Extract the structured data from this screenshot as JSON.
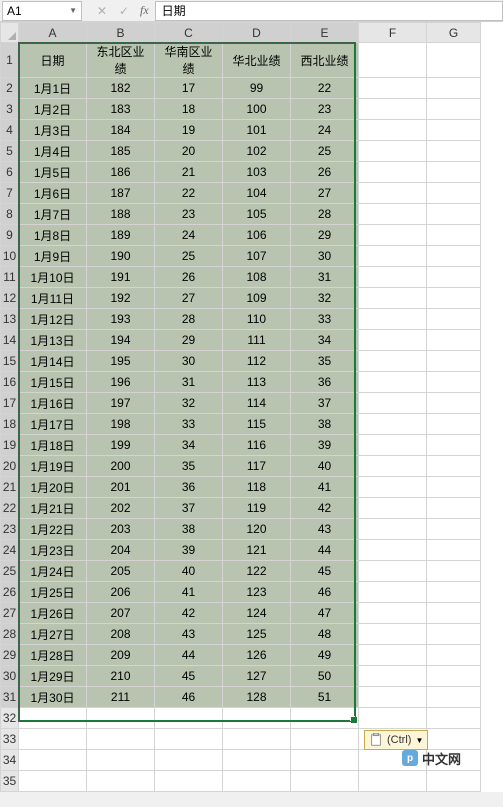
{
  "namebox": {
    "ref": "A1"
  },
  "formula_bar": {
    "value": "日期"
  },
  "columns": [
    "A",
    "B",
    "C",
    "D",
    "E",
    "F",
    "G"
  ],
  "row_headers": [
    1,
    2,
    3,
    4,
    5,
    6,
    7,
    8,
    9,
    10,
    11,
    12,
    13,
    14,
    15,
    16,
    17,
    18,
    19,
    20,
    21,
    22,
    23,
    24,
    25,
    26,
    27,
    28,
    29,
    30,
    31,
    32,
    33,
    34,
    35
  ],
  "headers": [
    "日期",
    "东北区业绩",
    "华南区业绩",
    "华北业绩",
    "西北业绩"
  ],
  "rows": [
    {
      "date": "1月1日",
      "ne": 182,
      "sc": 17,
      "nc": 99,
      "nw": 22
    },
    {
      "date": "1月2日",
      "ne": 183,
      "sc": 18,
      "nc": 100,
      "nw": 23
    },
    {
      "date": "1月3日",
      "ne": 184,
      "sc": 19,
      "nc": 101,
      "nw": 24
    },
    {
      "date": "1月4日",
      "ne": 185,
      "sc": 20,
      "nc": 102,
      "nw": 25
    },
    {
      "date": "1月5日",
      "ne": 186,
      "sc": 21,
      "nc": 103,
      "nw": 26
    },
    {
      "date": "1月6日",
      "ne": 187,
      "sc": 22,
      "nc": 104,
      "nw": 27
    },
    {
      "date": "1月7日",
      "ne": 188,
      "sc": 23,
      "nc": 105,
      "nw": 28
    },
    {
      "date": "1月8日",
      "ne": 189,
      "sc": 24,
      "nc": 106,
      "nw": 29
    },
    {
      "date": "1月9日",
      "ne": 190,
      "sc": 25,
      "nc": 107,
      "nw": 30
    },
    {
      "date": "1月10日",
      "ne": 191,
      "sc": 26,
      "nc": 108,
      "nw": 31
    },
    {
      "date": "1月11日",
      "ne": 192,
      "sc": 27,
      "nc": 109,
      "nw": 32
    },
    {
      "date": "1月12日",
      "ne": 193,
      "sc": 28,
      "nc": 110,
      "nw": 33
    },
    {
      "date": "1月13日",
      "ne": 194,
      "sc": 29,
      "nc": 111,
      "nw": 34
    },
    {
      "date": "1月14日",
      "ne": 195,
      "sc": 30,
      "nc": 112,
      "nw": 35
    },
    {
      "date": "1月15日",
      "ne": 196,
      "sc": 31,
      "nc": 113,
      "nw": 36
    },
    {
      "date": "1月16日",
      "ne": 197,
      "sc": 32,
      "nc": 114,
      "nw": 37
    },
    {
      "date": "1月17日",
      "ne": 198,
      "sc": 33,
      "nc": 115,
      "nw": 38
    },
    {
      "date": "1月18日",
      "ne": 199,
      "sc": 34,
      "nc": 116,
      "nw": 39
    },
    {
      "date": "1月19日",
      "ne": 200,
      "sc": 35,
      "nc": 117,
      "nw": 40
    },
    {
      "date": "1月20日",
      "ne": 201,
      "sc": 36,
      "nc": 118,
      "nw": 41
    },
    {
      "date": "1月21日",
      "ne": 202,
      "sc": 37,
      "nc": 119,
      "nw": 42
    },
    {
      "date": "1月22日",
      "ne": 203,
      "sc": 38,
      "nc": 120,
      "nw": 43
    },
    {
      "date": "1月23日",
      "ne": 204,
      "sc": 39,
      "nc": 121,
      "nw": 44
    },
    {
      "date": "1月24日",
      "ne": 205,
      "sc": 40,
      "nc": 122,
      "nw": 45
    },
    {
      "date": "1月25日",
      "ne": 206,
      "sc": 41,
      "nc": 123,
      "nw": 46
    },
    {
      "date": "1月26日",
      "ne": 207,
      "sc": 42,
      "nc": 124,
      "nw": 47
    },
    {
      "date": "1月27日",
      "ne": 208,
      "sc": 43,
      "nc": 125,
      "nw": 48
    },
    {
      "date": "1月28日",
      "ne": 209,
      "sc": 44,
      "nc": 126,
      "nw": 49
    },
    {
      "date": "1月29日",
      "ne": 210,
      "sc": 45,
      "nc": 127,
      "nw": 50
    },
    {
      "date": "1月30日",
      "ne": 211,
      "sc": 46,
      "nc": 128,
      "nw": 51
    }
  ],
  "paste_options": {
    "label": "(Ctrl)"
  },
  "watermark": {
    "text": "中文网"
  },
  "selection": {
    "top_row": 1,
    "bottom_row": 31,
    "left_col": "A",
    "right_col": "E"
  }
}
